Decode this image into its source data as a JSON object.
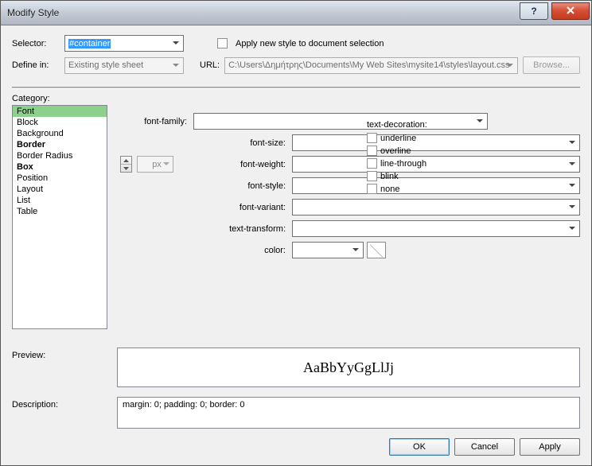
{
  "titlebar": {
    "title": "Modify Style"
  },
  "top": {
    "selector_label": "Selector:",
    "selector_value": "#container",
    "apply_checkbox_label": "Apply new style to document selection",
    "define_label": "Define in:",
    "define_value": "Existing style sheet",
    "url_label": "URL:",
    "url_value": "C:\\Users\\Δημήτρης\\Documents\\My Web Sites\\mysite14\\styles\\layout.css",
    "browse_label": "Browse..."
  },
  "category": {
    "label": "Category:",
    "items": [
      {
        "label": "Font",
        "selected": true,
        "bold": false
      },
      {
        "label": "Block",
        "selected": false,
        "bold": false
      },
      {
        "label": "Background",
        "selected": false,
        "bold": false
      },
      {
        "label": "Border",
        "selected": false,
        "bold": true
      },
      {
        "label": "Border Radius",
        "selected": false,
        "bold": false
      },
      {
        "label": "Box",
        "selected": false,
        "bold": true
      },
      {
        "label": "Position",
        "selected": false,
        "bold": false
      },
      {
        "label": "Layout",
        "selected": false,
        "bold": false
      },
      {
        "label": "List",
        "selected": false,
        "bold": false
      },
      {
        "label": "Table",
        "selected": false,
        "bold": false
      }
    ]
  },
  "props": {
    "font_family_label": "font-family:",
    "font_size_label": "font-size:",
    "font_size_unit": "px",
    "font_weight_label": "font-weight:",
    "font_style_label": "font-style:",
    "font_variant_label": "font-variant:",
    "text_transform_label": "text-transform:",
    "color_label": "color:"
  },
  "decoration": {
    "title": "text-decoration:",
    "items": [
      "underline",
      "overline",
      "line-through",
      "blink",
      "none"
    ]
  },
  "preview": {
    "label": "Preview:",
    "sample": "AaBbYyGgLlJj"
  },
  "description": {
    "label": "Description:",
    "text": "margin: 0; padding: 0; border: 0"
  },
  "footer": {
    "ok": "OK",
    "cancel": "Cancel",
    "apply": "Apply"
  }
}
